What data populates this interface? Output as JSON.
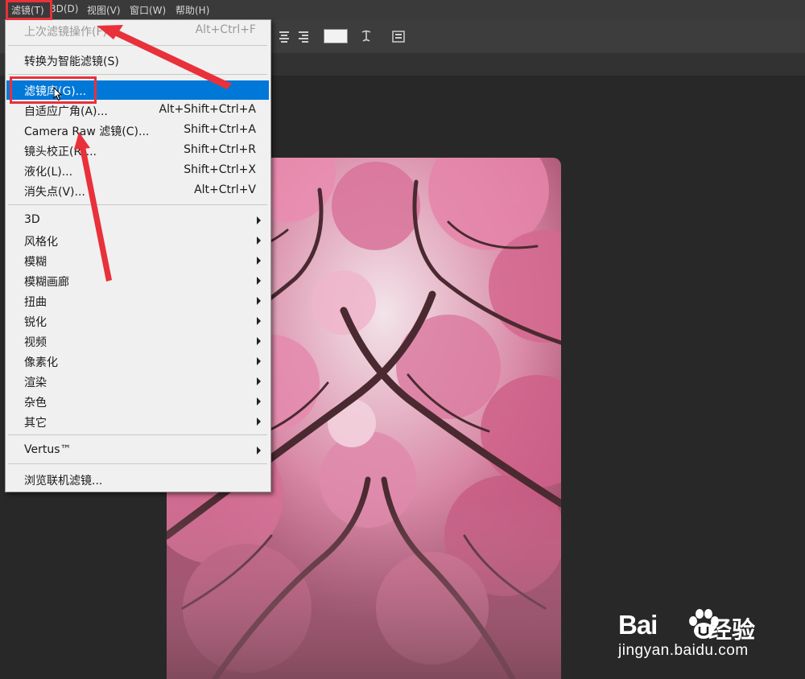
{
  "menubar": {
    "items": [
      {
        "label": "滤镜(T)"
      },
      {
        "label": "3D(D)"
      },
      {
        "label": "视图(V)"
      },
      {
        "label": "窗口(W)"
      },
      {
        "label": "帮助(H)"
      }
    ]
  },
  "filter_menu": {
    "last_filter": {
      "label": "上次滤镜操作(F)",
      "shortcut": "Alt+Ctrl+F"
    },
    "smart_filter": {
      "label": "转换为智能滤镜(S)"
    },
    "filter_gallery": {
      "label": "滤镜库(G)..."
    },
    "adaptive_wide_angle": {
      "label": "自适应广角(A)...",
      "shortcut": "Alt+Shift+Ctrl+A"
    },
    "camera_raw": {
      "label": "Camera Raw 滤镜(C)...",
      "shortcut": "Shift+Ctrl+A"
    },
    "lens_correction": {
      "label": "镜头校正(R)...",
      "shortcut": "Shift+Ctrl+R"
    },
    "liquify": {
      "label": "液化(L)...",
      "shortcut": "Shift+Ctrl+X"
    },
    "vanishing_point": {
      "label": "消失点(V)...",
      "shortcut": "Alt+Ctrl+V"
    },
    "submenus": [
      {
        "label": "3D"
      },
      {
        "label": "风格化"
      },
      {
        "label": "模糊"
      },
      {
        "label": "模糊画廊"
      },
      {
        "label": "扭曲"
      },
      {
        "label": "锐化"
      },
      {
        "label": "视频"
      },
      {
        "label": "像素化"
      },
      {
        "label": "渲染"
      },
      {
        "label": "杂色"
      },
      {
        "label": "其它"
      }
    ],
    "vertus": {
      "label": "Vertus™"
    },
    "browse_online": {
      "label": "浏览联机滤镜..."
    }
  },
  "watermark": {
    "brand_bai": "Bai",
    "brand_jy": "经验",
    "url": "jingyan.baidu.com"
  },
  "colors": {
    "highlight": "#0078d7",
    "annotation_red": "#e8313a",
    "canvas_bg": "#282828"
  }
}
